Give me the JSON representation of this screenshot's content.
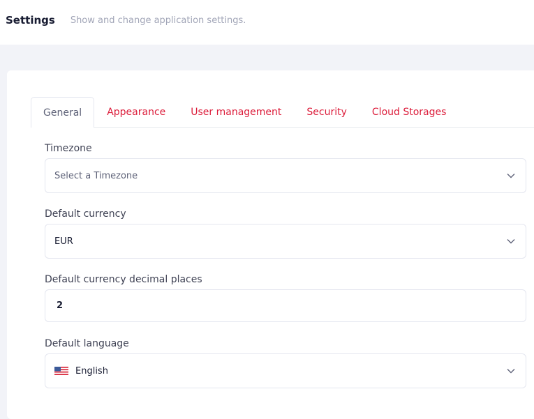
{
  "header": {
    "title": "Settings",
    "subtitle": "Show and change application settings."
  },
  "tabs": [
    {
      "label": "General",
      "active": true
    },
    {
      "label": "Appearance",
      "active": false
    },
    {
      "label": "User management",
      "active": false
    },
    {
      "label": "Security",
      "active": false
    },
    {
      "label": "Cloud Storages",
      "active": false
    }
  ],
  "form": {
    "timezone": {
      "label": "Timezone",
      "placeholder": "Select a Timezone",
      "value": ""
    },
    "currency": {
      "label": "Default currency",
      "value": "EUR"
    },
    "decimals": {
      "label": "Default currency decimal places",
      "value": "2"
    },
    "language": {
      "label": "Default language",
      "value": "English",
      "flag_icon": "us-flag-icon"
    }
  },
  "colors": {
    "accent": "#dc1c3a",
    "page_bg": "#f2f3f8",
    "border": "#e4e6ef"
  }
}
